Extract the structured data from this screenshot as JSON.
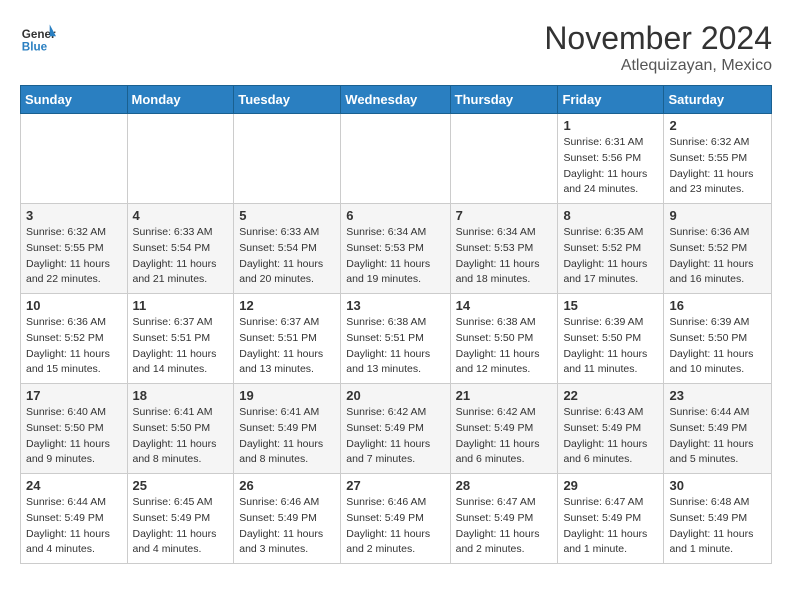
{
  "header": {
    "logo_line1": "General",
    "logo_line2": "Blue",
    "month": "November 2024",
    "location": "Atlequizayan, Mexico"
  },
  "weekdays": [
    "Sunday",
    "Monday",
    "Tuesday",
    "Wednesday",
    "Thursday",
    "Friday",
    "Saturday"
  ],
  "weeks": [
    [
      {
        "day": "",
        "info": ""
      },
      {
        "day": "",
        "info": ""
      },
      {
        "day": "",
        "info": ""
      },
      {
        "day": "",
        "info": ""
      },
      {
        "day": "",
        "info": ""
      },
      {
        "day": "1",
        "info": "Sunrise: 6:31 AM\nSunset: 5:56 PM\nDaylight: 11 hours and 24 minutes."
      },
      {
        "day": "2",
        "info": "Sunrise: 6:32 AM\nSunset: 5:55 PM\nDaylight: 11 hours and 23 minutes."
      }
    ],
    [
      {
        "day": "3",
        "info": "Sunrise: 6:32 AM\nSunset: 5:55 PM\nDaylight: 11 hours and 22 minutes."
      },
      {
        "day": "4",
        "info": "Sunrise: 6:33 AM\nSunset: 5:54 PM\nDaylight: 11 hours and 21 minutes."
      },
      {
        "day": "5",
        "info": "Sunrise: 6:33 AM\nSunset: 5:54 PM\nDaylight: 11 hours and 20 minutes."
      },
      {
        "day": "6",
        "info": "Sunrise: 6:34 AM\nSunset: 5:53 PM\nDaylight: 11 hours and 19 minutes."
      },
      {
        "day": "7",
        "info": "Sunrise: 6:34 AM\nSunset: 5:53 PM\nDaylight: 11 hours and 18 minutes."
      },
      {
        "day": "8",
        "info": "Sunrise: 6:35 AM\nSunset: 5:52 PM\nDaylight: 11 hours and 17 minutes."
      },
      {
        "day": "9",
        "info": "Sunrise: 6:36 AM\nSunset: 5:52 PM\nDaylight: 11 hours and 16 minutes."
      }
    ],
    [
      {
        "day": "10",
        "info": "Sunrise: 6:36 AM\nSunset: 5:52 PM\nDaylight: 11 hours and 15 minutes."
      },
      {
        "day": "11",
        "info": "Sunrise: 6:37 AM\nSunset: 5:51 PM\nDaylight: 11 hours and 14 minutes."
      },
      {
        "day": "12",
        "info": "Sunrise: 6:37 AM\nSunset: 5:51 PM\nDaylight: 11 hours and 13 minutes."
      },
      {
        "day": "13",
        "info": "Sunrise: 6:38 AM\nSunset: 5:51 PM\nDaylight: 11 hours and 13 minutes."
      },
      {
        "day": "14",
        "info": "Sunrise: 6:38 AM\nSunset: 5:50 PM\nDaylight: 11 hours and 12 minutes."
      },
      {
        "day": "15",
        "info": "Sunrise: 6:39 AM\nSunset: 5:50 PM\nDaylight: 11 hours and 11 minutes."
      },
      {
        "day": "16",
        "info": "Sunrise: 6:39 AM\nSunset: 5:50 PM\nDaylight: 11 hours and 10 minutes."
      }
    ],
    [
      {
        "day": "17",
        "info": "Sunrise: 6:40 AM\nSunset: 5:50 PM\nDaylight: 11 hours and 9 minutes."
      },
      {
        "day": "18",
        "info": "Sunrise: 6:41 AM\nSunset: 5:50 PM\nDaylight: 11 hours and 8 minutes."
      },
      {
        "day": "19",
        "info": "Sunrise: 6:41 AM\nSunset: 5:49 PM\nDaylight: 11 hours and 8 minutes."
      },
      {
        "day": "20",
        "info": "Sunrise: 6:42 AM\nSunset: 5:49 PM\nDaylight: 11 hours and 7 minutes."
      },
      {
        "day": "21",
        "info": "Sunrise: 6:42 AM\nSunset: 5:49 PM\nDaylight: 11 hours and 6 minutes."
      },
      {
        "day": "22",
        "info": "Sunrise: 6:43 AM\nSunset: 5:49 PM\nDaylight: 11 hours and 6 minutes."
      },
      {
        "day": "23",
        "info": "Sunrise: 6:44 AM\nSunset: 5:49 PM\nDaylight: 11 hours and 5 minutes."
      }
    ],
    [
      {
        "day": "24",
        "info": "Sunrise: 6:44 AM\nSunset: 5:49 PM\nDaylight: 11 hours and 4 minutes."
      },
      {
        "day": "25",
        "info": "Sunrise: 6:45 AM\nSunset: 5:49 PM\nDaylight: 11 hours and 4 minutes."
      },
      {
        "day": "26",
        "info": "Sunrise: 6:46 AM\nSunset: 5:49 PM\nDaylight: 11 hours and 3 minutes."
      },
      {
        "day": "27",
        "info": "Sunrise: 6:46 AM\nSunset: 5:49 PM\nDaylight: 11 hours and 2 minutes."
      },
      {
        "day": "28",
        "info": "Sunrise: 6:47 AM\nSunset: 5:49 PM\nDaylight: 11 hours and 2 minutes."
      },
      {
        "day": "29",
        "info": "Sunrise: 6:47 AM\nSunset: 5:49 PM\nDaylight: 11 hours and 1 minute."
      },
      {
        "day": "30",
        "info": "Sunrise: 6:48 AM\nSunset: 5:49 PM\nDaylight: 11 hours and 1 minute."
      }
    ]
  ]
}
